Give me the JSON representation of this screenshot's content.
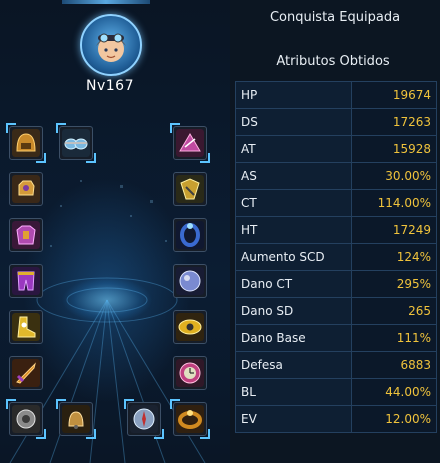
{
  "character": {
    "level": "Nv167"
  },
  "equipment": {
    "left_column": [
      {
        "name": "helmet",
        "color": "#c88a2a"
      },
      {
        "name": "hands",
        "color": "#d49a3a"
      },
      {
        "name": "armor",
        "color": "#b04ab0"
      },
      {
        "name": "pants",
        "color": "#9a38c0"
      },
      {
        "name": "boots",
        "color": "#e0b82c"
      },
      {
        "name": "weapon",
        "color": "#d88a20"
      },
      {
        "name": "belt",
        "color": "#8a8a8a"
      }
    ],
    "right_column": [
      {
        "name": "necklace",
        "color": "#c04aa0"
      },
      {
        "name": "earring",
        "color": "#c8a030"
      },
      {
        "name": "ring",
        "color": "#3a6ad0"
      },
      {
        "name": "orb",
        "color": "#7a8ad0"
      },
      {
        "name": "eye-charm",
        "color": "#e0b020"
      },
      {
        "name": "clock-charm",
        "color": "#c04080"
      },
      {
        "name": "bracelet",
        "color": "#d08a20"
      }
    ],
    "extras": [
      {
        "name": "goggles",
        "color": "#7ab8e0"
      },
      {
        "name": "bell",
        "color": "#c09040"
      },
      {
        "name": "compass",
        "color": "#8aa0c0"
      }
    ]
  },
  "panel": {
    "conquest_title": "Conquista Equipada",
    "attributes_title": "Atributos Obtidos"
  },
  "attributes": [
    {
      "name": "HP",
      "value": "19674"
    },
    {
      "name": "DS",
      "value": "17263"
    },
    {
      "name": "AT",
      "value": "15928"
    },
    {
      "name": "AS",
      "value": "30.00%"
    },
    {
      "name": "CT",
      "value": "114.00%"
    },
    {
      "name": "HT",
      "value": "17249"
    },
    {
      "name": "Aumento SCD",
      "value": "124%"
    },
    {
      "name": "Dano CT",
      "value": "295%"
    },
    {
      "name": "Dano SD",
      "value": "265"
    },
    {
      "name": "Dano Base",
      "value": "111%"
    },
    {
      "name": "Defesa",
      "value": "6883"
    },
    {
      "name": "BL",
      "value": "44.00%"
    },
    {
      "name": "EV",
      "value": "12.00%"
    }
  ]
}
